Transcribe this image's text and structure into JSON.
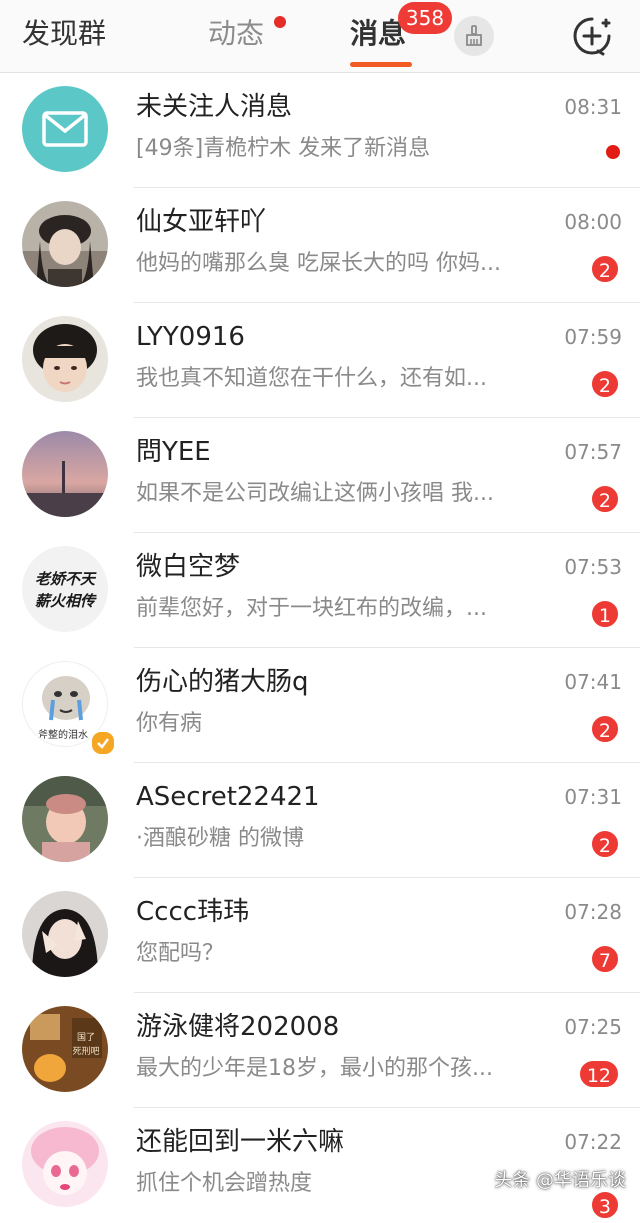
{
  "topbar": {
    "tab_discover": "发现群",
    "tab_dynamic": "动态",
    "tab_messages": "消息",
    "messages_badge": "358",
    "icons": {
      "clear": "broom-icon",
      "add": "plus-circle-icon"
    }
  },
  "conversations": [
    {
      "name": "未关注人消息",
      "preview": "[49条]青桅柠木 发来了新消息",
      "time": "08:31",
      "badge": "",
      "dot": true
    },
    {
      "name": "仙女亚轩吖",
      "preview": "他妈的嘴那么臭 吃屎长大的吗 你妈...",
      "time": "08:00",
      "badge": "2"
    },
    {
      "name": "LYY0916",
      "preview": "我也真不知道您在干什么，还有如...",
      "time": "07:59",
      "badge": "2"
    },
    {
      "name": "問YEE",
      "preview": "如果不是公司改编让这俩小孩唱  我...",
      "time": "07:57",
      "badge": "2"
    },
    {
      "name": "微白空梦",
      "preview": "前辈您好，对于一块红布的改编，...",
      "time": "07:53",
      "badge": "1"
    },
    {
      "name": "伤心的猪大肠q",
      "preview": "你有病",
      "time": "07:41",
      "badge": "2",
      "verified": true
    },
    {
      "name": "ASecret22421",
      "preview": "·酒酿砂糖 的微博",
      "time": "07:31",
      "badge": "2"
    },
    {
      "name": "Cccc玮玮",
      "preview": "您配吗？",
      "time": "07:28",
      "badge": "7"
    },
    {
      "name": "游泳健将202008",
      "preview": "最大的少年是18岁，最小的那个孩...",
      "time": "07:25",
      "badge": "12"
    },
    {
      "name": "还能回到一米六嘛",
      "preview": "抓住个机会蹭热度",
      "time": "07:22",
      "badge": "3"
    }
  ],
  "avatar_text": {
    "row4": "老娇不天\n薪火相传",
    "row5": "斧整的泪水",
    "row8": "国了 死刑吧"
  },
  "watermark": "头条 @华语乐谈",
  "colors": {
    "accent": "#f15a22",
    "badge": "#ee3a34",
    "mail": "#5cc7c7"
  }
}
